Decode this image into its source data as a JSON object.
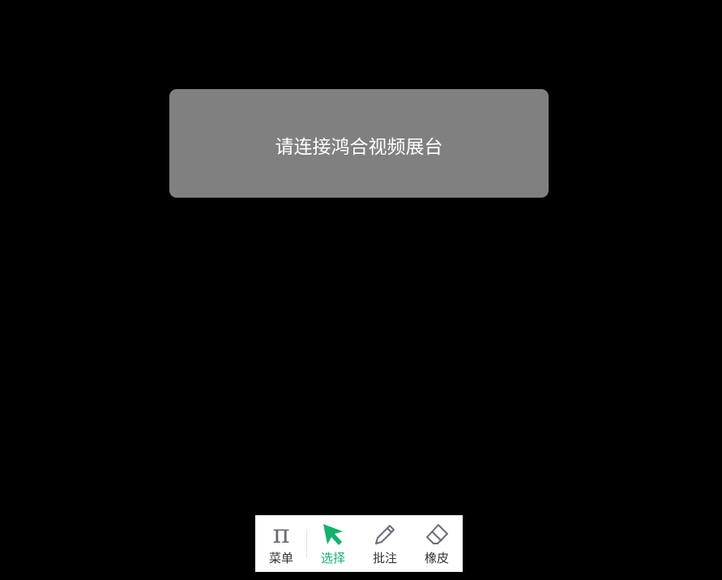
{
  "notice": {
    "message": "请连接鸿合视频展台"
  },
  "toolbar": {
    "items": [
      {
        "label": "菜单",
        "icon": "pi-menu-icon",
        "active": false
      },
      {
        "label": "选择",
        "icon": "cursor-arrow-icon",
        "active": true
      },
      {
        "label": "批注",
        "icon": "pencil-icon",
        "active": false
      },
      {
        "label": "橡皮",
        "icon": "eraser-icon",
        "active": false
      }
    ],
    "menu_glyph": "π"
  },
  "colors": {
    "background": "#000000",
    "notice_background": "#808080",
    "accent": "#12b26b",
    "icon_gray": "#6b6b78"
  }
}
